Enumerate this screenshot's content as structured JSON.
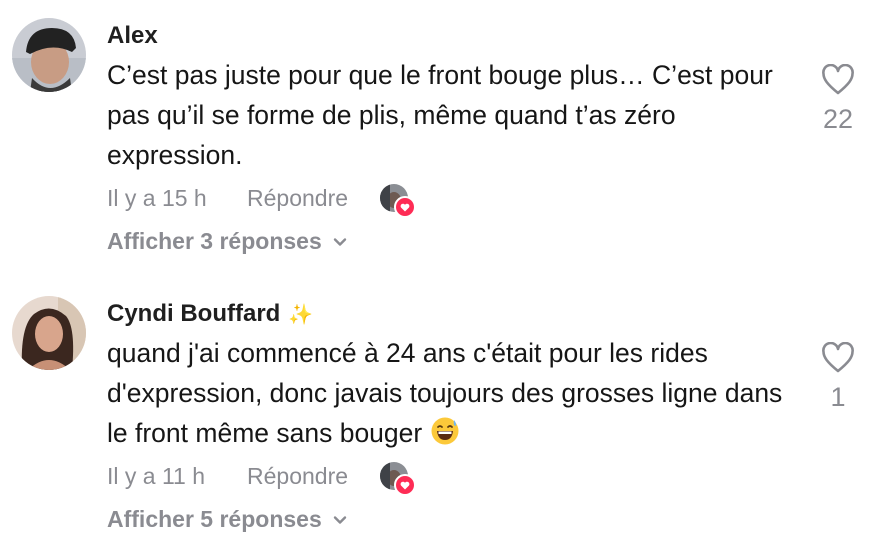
{
  "comments": [
    {
      "username": "Alex",
      "text": "C’est pas juste pour que le front bouge plus… C’est pour pas qu’il se forme de plis, même quand t’as zéro expression.",
      "time": "Il y a 15 h",
      "reply_label": "Répondre",
      "view_replies": "Afficher 3 réponses",
      "likes": "22"
    },
    {
      "username": "Cyndi Bouffard",
      "username_badge": "✨",
      "text": "quand j'ai commencé à 24 ans c'était pour les rides d'expression, donc javais toujours des grosses ligne dans le front même sans bouger",
      "time": "Il y a 11 h",
      "reply_label": "Répondre",
      "view_replies": "Afficher 5 réponses",
      "likes": "1"
    }
  ],
  "colors": {
    "muted": "#8a8b91",
    "like_badge": "#fe2c55"
  },
  "icons": [
    "heart-outline-icon",
    "chevron-down-icon",
    "heart-badge-icon",
    "grinning-sweat-emoji"
  ]
}
